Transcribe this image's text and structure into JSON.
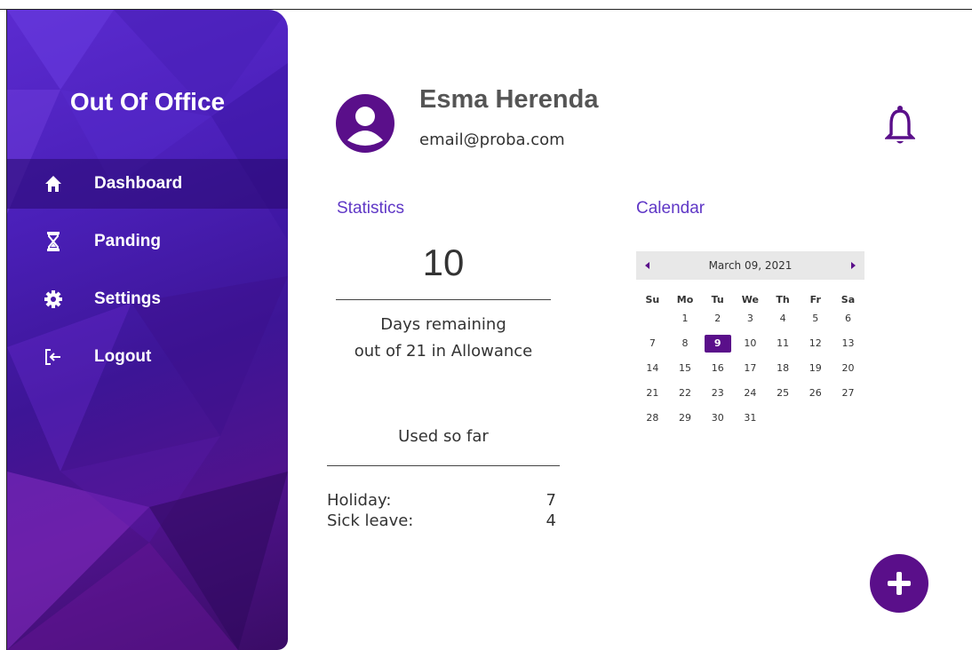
{
  "sidebar": {
    "brand": "Out Of Office",
    "items": [
      {
        "label": "Dashboard",
        "icon": "home-icon",
        "active": true
      },
      {
        "label": "Panding",
        "icon": "hourglass-icon",
        "active": false
      },
      {
        "label": "Settings",
        "icon": "gear-icon",
        "active": false
      },
      {
        "label": "Logout",
        "icon": "logout-icon",
        "active": false
      }
    ]
  },
  "header": {
    "name": "Esma Herenda",
    "email": "email@proba.com",
    "avatar_icon": "user-avatar-icon",
    "notification_icon": "bell-icon"
  },
  "statistics": {
    "title": "Statistics",
    "remaining": "10",
    "remaining_line1": "Days remaining",
    "remaining_line2": "out of 21 in Allowance",
    "used_title": "Used so far",
    "rows": [
      {
        "label": "Holiday:",
        "value": "7"
      },
      {
        "label": "Sick leave:",
        "value": "4"
      }
    ]
  },
  "calendar": {
    "title": "Calendar",
    "month_label": "March 09, 2021",
    "weekdays": [
      "Su",
      "Mo",
      "Tu",
      "We",
      "Th",
      "Fr",
      "Sa"
    ],
    "first_weekday_index": 1,
    "days_in_month": 31,
    "selected_day": 9
  },
  "fab": {
    "icon": "plus-icon"
  },
  "colors": {
    "accent": "#5a0f8a",
    "section_title": "#5f37c6",
    "sidebar_gradient": [
      "#5b2bd0",
      "#3a0c66"
    ]
  }
}
